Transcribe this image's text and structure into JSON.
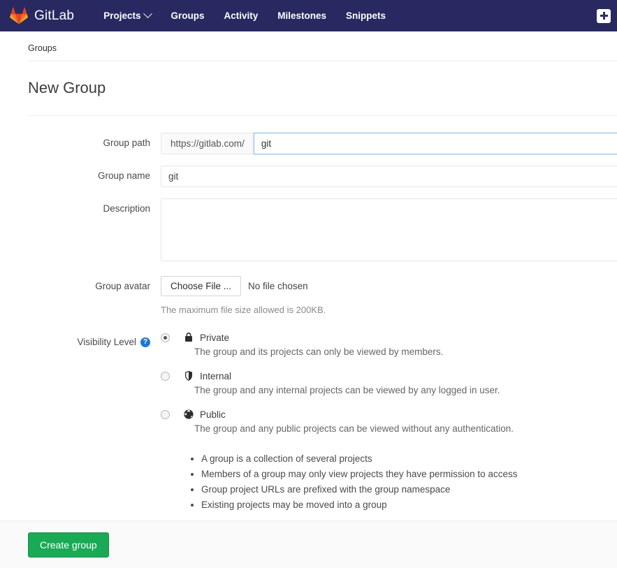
{
  "navbar": {
    "brand": "GitLab",
    "logo_icon": "gitlab-tanuki-icon",
    "links": [
      {
        "label": "Projects",
        "has_caret": true
      },
      {
        "label": "Groups",
        "has_caret": false
      },
      {
        "label": "Activity",
        "has_caret": false
      },
      {
        "label": "Milestones",
        "has_caret": false
      },
      {
        "label": "Snippets",
        "has_caret": false
      }
    ],
    "new_button_icon": "plus-icon",
    "background_color": "#292961"
  },
  "breadcrumb": {
    "items": [
      "Groups"
    ]
  },
  "page": {
    "title": "New Group"
  },
  "form": {
    "group_path": {
      "label": "Group path",
      "prefix": "https://gitlab.com/",
      "value": "git",
      "placeholder": "",
      "focused": true
    },
    "group_name": {
      "label": "Group name",
      "value": "git",
      "placeholder": ""
    },
    "description": {
      "label": "Description",
      "value": "",
      "placeholder": ""
    },
    "group_avatar": {
      "label": "Group avatar",
      "button_label": "Choose File ...",
      "file_status": "No file chosen",
      "help_text": "The maximum file size allowed is 200KB."
    },
    "visibility": {
      "label": "Visibility Level",
      "help_icon": "question-mark-help-icon",
      "options": [
        {
          "name": "Private",
          "icon": "lock-icon",
          "description": "The group and its projects can only be viewed by members.",
          "selected": true
        },
        {
          "name": "Internal",
          "icon": "shield-icon",
          "description": "The group and any internal projects can be viewed by any logged in user.",
          "selected": false
        },
        {
          "name": "Public",
          "icon": "globe-icon",
          "description": "The group and any public projects can be viewed without any authentication.",
          "selected": false
        }
      ],
      "bullets": [
        "A group is a collection of several projects",
        "Members of a group may only view projects they have permission to access",
        "Group project URLs are prefixed with the group namespace",
        "Existing projects may be moved into a group"
      ]
    }
  },
  "footer": {
    "submit_label": "Create group",
    "submit_color": "#1aaa55"
  }
}
